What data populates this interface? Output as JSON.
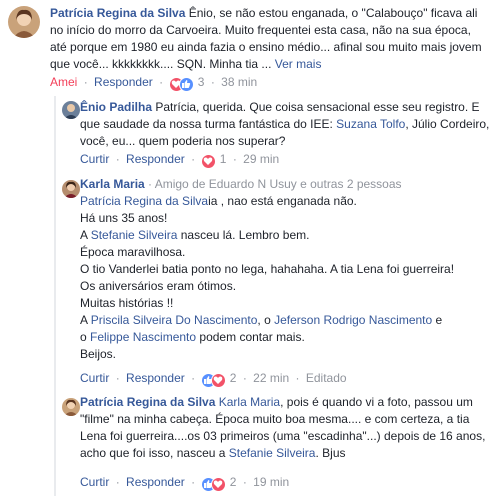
{
  "colors": {
    "link": "#365899",
    "meta": "#90949c",
    "love": "#f25268",
    "like": "#5890ff",
    "text": "#1d2129"
  },
  "comments": [
    {
      "author": "Patrícia Regina da Silva",
      "body": "Ênio, se não estou enganada, o \"Calabouço\" ficava ali no início do morro da Carvoeira. Muito frequentei esta casa, não na sua época, até porque em 1980 eu ainda fazia o ensino médio... afinal sou muito mais jovem que você... kkkkkkkk.... SQN. Minha tia ...",
      "see_more": "Ver mais",
      "reacted": "Amei",
      "reply": "Responder",
      "reaction_count": "3",
      "time": "38 min",
      "reaction_icons": [
        "heart-icon",
        "like-icon"
      ]
    },
    {
      "author": "Ênio Padilha",
      "body_start": "Patrícia, querida. Que coisa sensacional esse seu registro. E que saudade da nossa turma fantástica do IEE: ",
      "mention_1": "Suzana Tolfo",
      "body_end": ", Júlio Cordeiro, você, eu... quem poderia nos superar?",
      "like": "Curtir",
      "reply": "Responder",
      "reaction_count": "1",
      "time": "29 min",
      "reaction_icons": [
        "heart-icon"
      ]
    },
    {
      "author": "Karla Maria",
      "friend_info": "Amigo de Eduardo N Usuy e outras 2 pessoas",
      "mention_patricia": "Patrícia Regina da Silva",
      "line1_end": "ia , nao está enganada não.",
      "line2": "Há uns 35 anos!",
      "line3_pre": "A ",
      "mention_stefanie": "Stefanie Silveira",
      "line3_post": " nasceu lá. Lembro bem.",
      "line4": "Época maravilhosa.",
      "line5": "O tio Vanderlei batia ponto no lega, hahahaha. A tia Lena foi guerreira!",
      "line6": "Os aniversários eram ótimos.",
      "line7": "Muitas histórias !!",
      "line8_pre": "A ",
      "mention_priscila": "Priscila Silveira Do Nascimento",
      "line8_mid": ", o ",
      "mention_jeferson": "Jeferson Rodrigo Nascimento",
      "line8_post": " e",
      "line9_pre": "o ",
      "mention_felippe": "Felippe Nascimento",
      "line9_post": " podem contar mais.",
      "line10": "Beijos.",
      "like": "Curtir",
      "reply": "Responder",
      "reaction_count": "2",
      "time": "22 min",
      "edited": "Editado",
      "reaction_icons": [
        "like-icon",
        "heart-icon"
      ]
    },
    {
      "author": "Patrícia Regina da Silva",
      "mention_karla": "Karla Maria",
      "body": ", pois é quando vi a foto, passou um \"filme\" na minha cabeça. Época muito boa mesma.... e com certeza, a tia Lena foi guerreira....os 03 primeiros (uma \"escadinha\"...) depois de 16 anos, acho que foi isso, nasceu a ",
      "mention_stefanie": "Stefanie Silveira",
      "body_end": ". Bjus",
      "like": "Curtir",
      "reply": "Responder",
      "reaction_count": "2",
      "time": "19 min",
      "reaction_icons": [
        "like-icon",
        "heart-icon"
      ]
    }
  ]
}
